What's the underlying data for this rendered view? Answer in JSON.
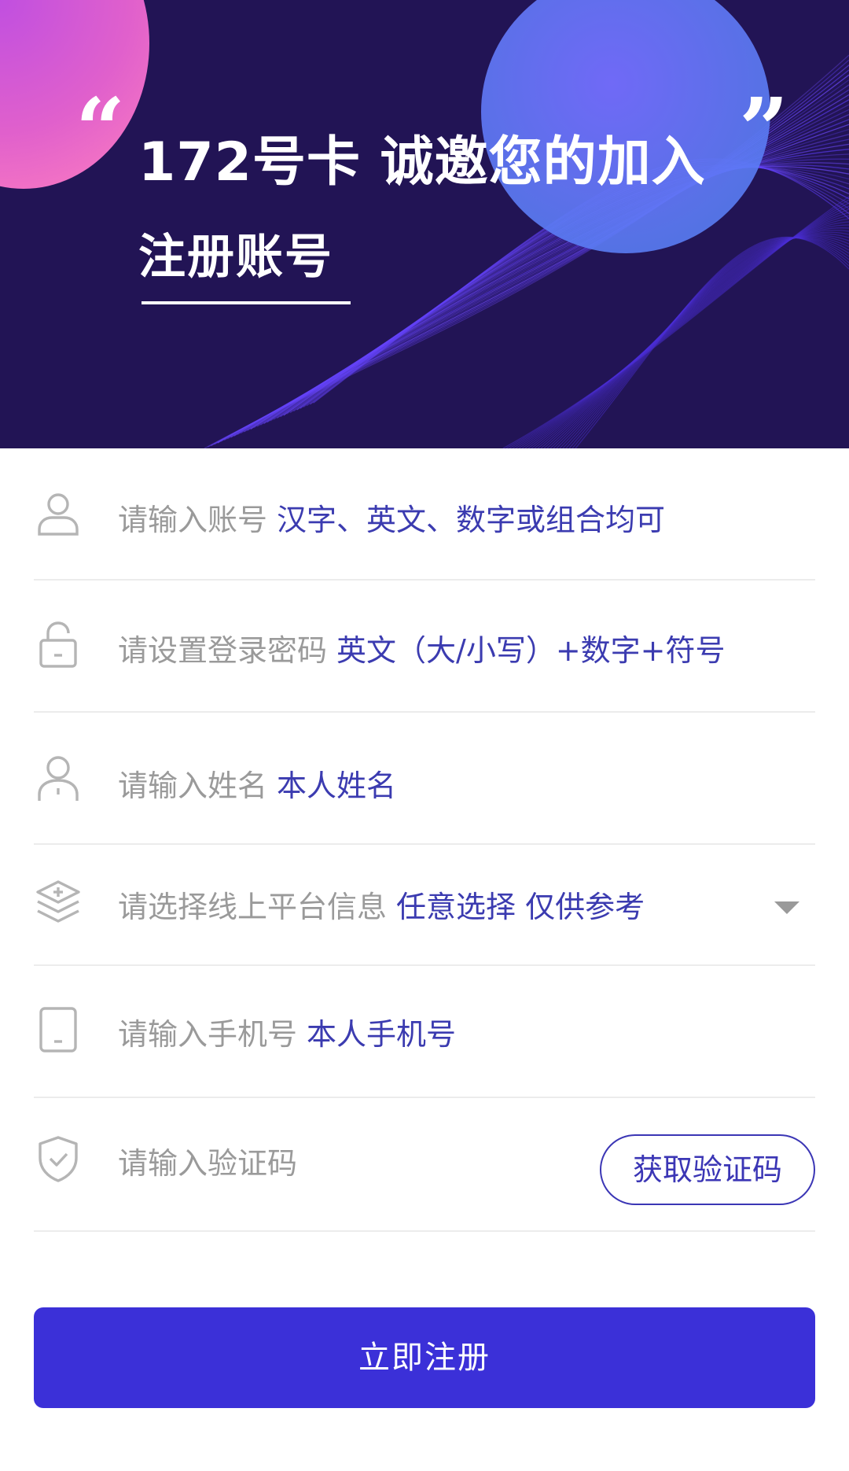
{
  "banner": {
    "quote_open": "“",
    "title": "172号卡 诚邀您的加入",
    "quote_close": "”",
    "subtitle": "注册账号"
  },
  "form": {
    "fields": [
      {
        "icon": "user-icon",
        "placeholder": "请输入账号",
        "hint": "汉字、英文、数字或组合均可"
      },
      {
        "icon": "lock-icon",
        "placeholder": "请设置登录密码",
        "hint": "英文（大/小写）+数字+符号"
      },
      {
        "icon": "person-icon",
        "placeholder": "请输入姓名",
        "hint": "本人姓名"
      },
      {
        "icon": "layers-icon",
        "placeholder": "请选择线上平台信息",
        "hint": "任意选择 仅供参考"
      },
      {
        "icon": "phone-icon",
        "placeholder": "请输入手机号",
        "hint": "本人手机号"
      },
      {
        "icon": "shield-check-icon",
        "placeholder": "请输入验证码",
        "hint": ""
      }
    ],
    "get_code_label": "获取验证码"
  },
  "submit_label": "立即注册",
  "colors": {
    "banner_bg": "#221455",
    "accent": "#3b30d8",
    "hint_text": "#3b3bb0",
    "placeholder_text": "#9a9a9a"
  }
}
